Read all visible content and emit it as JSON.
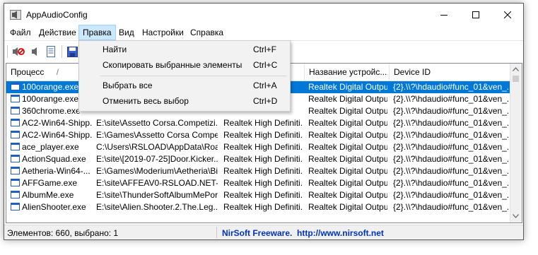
{
  "window": {
    "title": "AppAudioConfig"
  },
  "menubar": [
    {
      "label": "Файл"
    },
    {
      "label": "Действие"
    },
    {
      "label": "Правка"
    },
    {
      "label": "Вид"
    },
    {
      "label": "Настройки"
    },
    {
      "label": "Справка"
    }
  ],
  "edit_menu": {
    "items": [
      {
        "label": "Найти",
        "shortcut": "Ctrl+F"
      },
      {
        "label": "Скопировать выбранные элементы",
        "shortcut": "Ctrl+C"
      },
      {
        "label": "Выбрать все",
        "shortcut": "Ctrl+A"
      },
      {
        "label": "Отменить весь выбор",
        "shortcut": "Ctrl+D"
      }
    ]
  },
  "toolbar": {
    "icons": [
      "mute-icon",
      "unmute-icon",
      "properties-icon",
      "save-icon"
    ]
  },
  "table": {
    "columns": [
      "Процесс",
      "",
      "",
      "Название устройс...",
      "Device ID"
    ],
    "sort_indicator": "/",
    "rows": [
      [
        "100orange.exe",
        "",
        "",
        "Realtek Digital Output",
        "{2}.\\\\?\\hdaudio#func_01&ven_..."
      ],
      [
        "100orange.exe",
        "",
        "",
        "Realtek Digital Output",
        "{2}.\\\\?\\hdaudio#func_01&ven_..."
      ],
      [
        "360chrome.exe",
        "",
        "",
        "Realtek Digital Output",
        "{2}.\\\\?\\hdaudio#func_01&ven_..."
      ],
      [
        "AC2-Win64-Shipp...",
        "E:\\site\\Assetto Corsa.Competizi...",
        "Realtek High Definiti...",
        "Realtek Digital Output",
        "{2}.\\\\?\\hdaudio#func_01&ven_..."
      ],
      [
        "AC2-Win64-Shipp...",
        "E:\\Games\\Assetto Corsa Compe...",
        "Realtek High Definiti...",
        "Realtek Digital Output",
        "{2}.\\\\?\\hdaudio#func_01&ven_..."
      ],
      [
        "ace_player.exe",
        "C:\\Users\\RSLOAD\\AppData\\Roa...",
        "Realtek High Definiti...",
        "Realtek Digital Output",
        "{2}.\\\\?\\hdaudio#func_01&ven_..."
      ],
      [
        "ActionSquad.exe",
        "E:\\site\\[2019-07-25]Door.Kicker...",
        "Realtek High Definiti...",
        "Realtek Digital Output",
        "{2}.\\\\?\\hdaudio#func_01&ven_..."
      ],
      [
        "Aetheria-Win64-...",
        "E:\\Games\\Moderium\\Aetheria\\Bi...",
        "Realtek High Definiti...",
        "Realtek Digital Output",
        "{2}.\\\\?\\hdaudio#func_01&ven_..."
      ],
      [
        "AFFGame.exe",
        "E:\\site\\AFFEAV0-RSLOAD.NET-\\...",
        "Realtek High Definiti...",
        "Realtek Digital Output",
        "{2}.\\\\?\\hdaudio#func_01&ven_..."
      ],
      [
        "AlbumMe.exe",
        "E:\\site\\ThunderSoftAlbumMePor...",
        "Realtek High Definiti...",
        "Realtek Digital Output",
        "{2}.\\\\?\\hdaudio#func_01&ven_..."
      ],
      [
        "AlienShooter.exe",
        "E:\\site\\Alien.Shooter.2.The.Leg...",
        "Realtek High Definiti...",
        "Realtek Digital Output",
        "{2}.\\\\?\\hdaudio#func_01&ven_..."
      ]
    ]
  },
  "status": {
    "left": "Элементов: 660, выбрано: 1",
    "right": "NirSoft Freeware.  http://www.nirsoft.net"
  }
}
